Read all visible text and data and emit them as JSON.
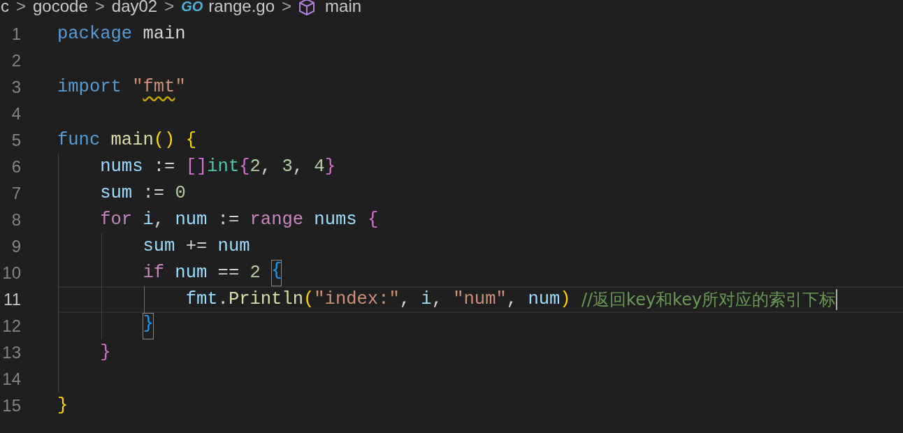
{
  "breadcrumb": [
    {
      "kind": "folder",
      "label": "c"
    },
    {
      "kind": "folder",
      "label": "gocode"
    },
    {
      "kind": "folder",
      "label": "day02"
    },
    {
      "kind": "file",
      "label": "range.go",
      "icon_text": "GO"
    },
    {
      "kind": "symbol",
      "label": "main"
    }
  ],
  "breadcrumb_separator": ">",
  "lines": [
    {
      "number": "1",
      "current": false,
      "tokens": [
        {
          "kind": "keyword",
          "text": "package"
        },
        {
          "kind": "plain",
          "text": " main"
        }
      ]
    },
    {
      "number": "2",
      "current": false
    },
    {
      "number": "3",
      "current": false,
      "tokens": [
        {
          "kind": "keyword",
          "text": "import"
        },
        {
          "kind": "string",
          "text": " \""
        },
        {
          "kind": "string",
          "text": "fmt",
          "warning": true
        },
        {
          "kind": "string",
          "text": "\""
        }
      ]
    },
    {
      "number": "4",
      "current": false
    },
    {
      "number": "5",
      "current": false,
      "tokens": [
        {
          "kind": "keyword",
          "text": "func"
        },
        {
          "kind": "function",
          "text": " main"
        },
        {
          "kind": "bracket1",
          "text": "()"
        },
        {
          "kind": "bracket1",
          "text": " {"
        }
      ]
    },
    {
      "number": "6",
      "current": false,
      "tokens": [
        {
          "kind": "variable",
          "text": "    nums"
        },
        {
          "kind": "plain",
          "text": " := "
        },
        {
          "kind": "bracket2",
          "text": "[]"
        },
        {
          "kind": "type",
          "text": "int"
        },
        {
          "kind": "bracket2",
          "text": "{"
        },
        {
          "kind": "number",
          "text": "2"
        },
        {
          "kind": "plain",
          "text": ", "
        },
        {
          "kind": "number",
          "text": "3"
        },
        {
          "kind": "plain",
          "text": ", "
        },
        {
          "kind": "number",
          "text": "4"
        },
        {
          "kind": "bracket2",
          "text": "}"
        }
      ]
    },
    {
      "number": "7",
      "current": false,
      "tokens": [
        {
          "kind": "variable",
          "text": "    sum"
        },
        {
          "kind": "plain",
          "text": " := "
        },
        {
          "kind": "number",
          "text": "0"
        }
      ]
    },
    {
      "number": "8",
      "current": false,
      "tokens": [
        {
          "kind": "control",
          "text": "    for"
        },
        {
          "kind": "variable",
          "text": " i"
        },
        {
          "kind": "plain",
          "text": ", "
        },
        {
          "kind": "variable",
          "text": "num"
        },
        {
          "kind": "plain",
          "text": " := "
        },
        {
          "kind": "control",
          "text": "range"
        },
        {
          "kind": "variable",
          "text": " nums"
        },
        {
          "kind": "bracket2",
          "text": " {"
        }
      ]
    },
    {
      "number": "9",
      "current": false,
      "tokens": [
        {
          "kind": "variable",
          "text": "        sum"
        },
        {
          "kind": "plain",
          "text": " += "
        },
        {
          "kind": "variable",
          "text": "num"
        }
      ]
    },
    {
      "number": "10",
      "current": false,
      "tokens": [
        {
          "kind": "control",
          "text": "        if"
        },
        {
          "kind": "variable",
          "text": " num"
        },
        {
          "kind": "plain",
          "text": " == "
        },
        {
          "kind": "number",
          "text": "2"
        },
        {
          "kind": "bracket3",
          "text": " {",
          "matched": true
        }
      ]
    },
    {
      "number": "11",
      "current": true,
      "tokens": [
        {
          "kind": "variable",
          "text": "            fmt"
        },
        {
          "kind": "plain",
          "text": "."
        },
        {
          "kind": "function",
          "text": "Println"
        },
        {
          "kind": "bracket1",
          "text": "("
        },
        {
          "kind": "string",
          "text": "\"index:\""
        },
        {
          "kind": "plain",
          "text": ", "
        },
        {
          "kind": "variable",
          "text": "i"
        },
        {
          "kind": "plain",
          "text": ", "
        },
        {
          "kind": "string",
          "text": "\"num\""
        },
        {
          "kind": "plain",
          "text": ", "
        },
        {
          "kind": "variable",
          "text": "num"
        },
        {
          "kind": "bracket1",
          "text": ")"
        },
        {
          "kind": "comment",
          "text": " //返回key和key所对应的索引下标"
        }
      ]
    },
    {
      "number": "12",
      "current": false,
      "tokens": [
        {
          "kind": "bracket3",
          "text": "        }",
          "matched": true
        }
      ]
    },
    {
      "number": "13",
      "current": false,
      "tokens": [
        {
          "kind": "bracket2",
          "text": "    }"
        }
      ]
    },
    {
      "number": "14",
      "current": false
    },
    {
      "number": "15",
      "current": false,
      "tokens": [
        {
          "kind": "bracket1",
          "text": "}"
        }
      ]
    }
  ]
}
